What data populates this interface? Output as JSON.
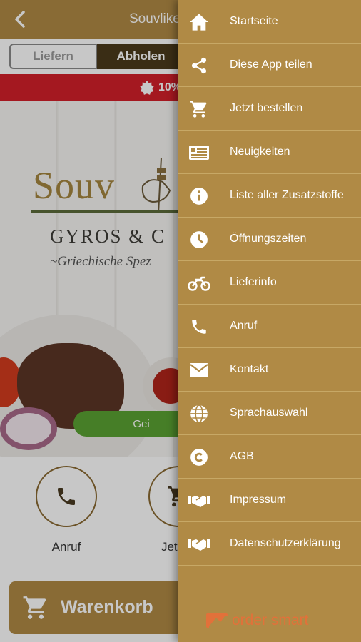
{
  "app": {
    "title": "Souvlike",
    "segment": {
      "liefern": "Liefern",
      "abholen": "Abholen",
      "selected": "Abholen"
    },
    "promo": "10%",
    "hero": {
      "logo_word": "Souv",
      "subtitle": "GYROS & C",
      "tagline": "~Griechische Spez",
      "status_button": "Gei"
    },
    "actions": [
      {
        "label": "Anruf",
        "icon": "phone-icon"
      },
      {
        "label": "Jetzt b",
        "icon": "cart-icon"
      }
    ],
    "cart_label": "Warenkorb"
  },
  "drawer": {
    "items": [
      {
        "label": "Startseite",
        "icon": "home-icon"
      },
      {
        "label": "Diese App teilen",
        "icon": "share-icon"
      },
      {
        "label": "Jetzt bestellen",
        "icon": "cart-icon"
      },
      {
        "label": "Neuigkeiten",
        "icon": "news-icon"
      },
      {
        "label": "Liste aller Zusatzstoffe",
        "icon": "info-icon"
      },
      {
        "label": "Öffnungszeiten",
        "icon": "clock-icon"
      },
      {
        "label": "Lieferinfo",
        "icon": "motorbike-icon"
      },
      {
        "label": "Anruf",
        "icon": "phone-icon"
      },
      {
        "label": "Kontakt",
        "icon": "mail-icon"
      },
      {
        "label": "Sprachauswahl",
        "icon": "globe-icon"
      },
      {
        "label": "AGB",
        "icon": "copyright-icon"
      },
      {
        "label": "Impressum",
        "icon": "handshake-icon"
      },
      {
        "label": "Datenschutzerklärung",
        "icon": "handshake-icon"
      }
    ],
    "footer_brand": "order smart"
  },
  "colors": {
    "brand_gold": "#b08a45",
    "promo_red": "#d21f2a",
    "open_green": "#5aa232",
    "segment_dark": "#4b3a1c",
    "order_smart_orange": "#e2713a"
  }
}
